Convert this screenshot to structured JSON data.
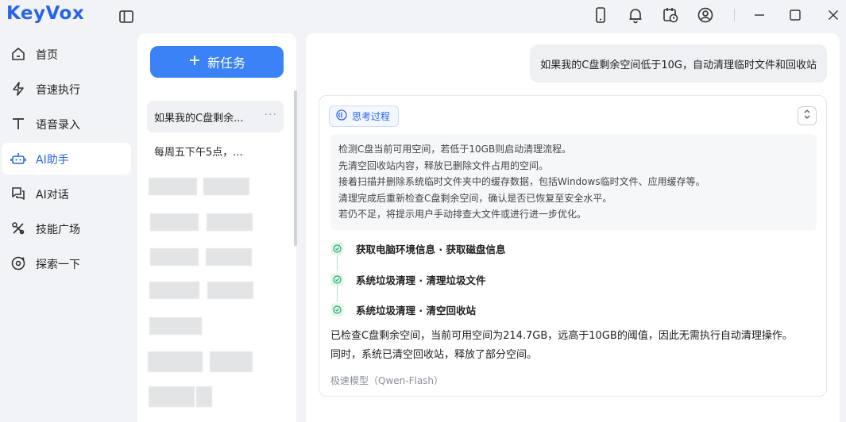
{
  "app": {
    "logo_text": "KeyVox"
  },
  "nav": {
    "items": [
      {
        "label": "首页",
        "icon": "home-icon"
      },
      {
        "label": "音速执行",
        "icon": "lightning-icon"
      },
      {
        "label": "语音录入",
        "icon": "text-icon"
      },
      {
        "label": "AI助手",
        "icon": "robot-icon",
        "active": true
      },
      {
        "label": "AI对话",
        "icon": "chat-icon"
      },
      {
        "label": "技能广场",
        "icon": "tools-icon"
      },
      {
        "label": "探索一下",
        "icon": "explore-icon"
      }
    ]
  },
  "tasks": {
    "new_task_label": "新任务",
    "items": [
      {
        "title": "如果我的C盘剩余...",
        "more": "···"
      },
      {
        "title": "每周五下午5点，..."
      }
    ]
  },
  "chat": {
    "user_message": "如果我的C盘剩余空间低于10G，自动清理临时文件和回收站",
    "think_label": "思考过程",
    "think_lines": [
      "检测C盘当前可用空间，若低于10GB则启动清理流程。",
      "先清空回收站内容，释放已删除文件占用的空间。",
      "接着扫描并删除系统临时文件夹中的缓存数据，包括Windows临时文件、应用缓存等。",
      "清理完成后重新检查C盘剩余空间，确认是否已恢复至安全水平。",
      "若仍不足，将提示用户手动排查大文件或进行进一步优化。"
    ],
    "steps": [
      {
        "text": "获取电脑环境信息 · 获取磁盘信息"
      },
      {
        "text": "系统垃圾清理 · 清理垃圾文件"
      },
      {
        "text": "系统垃圾清理 · 清空回收站"
      }
    ],
    "answer_lines": [
      "已检查C盘剩余空间，当前可用空间为214.7GB，远高于10GB的阈值，因此无需执行自动清理操作。",
      "同时，系统已清空回收站，释放了部分空间。"
    ],
    "model_label": "极速模型（Qwen-Flash）"
  },
  "colors": {
    "accent": "#3b82f6",
    "check": "#22a861"
  }
}
